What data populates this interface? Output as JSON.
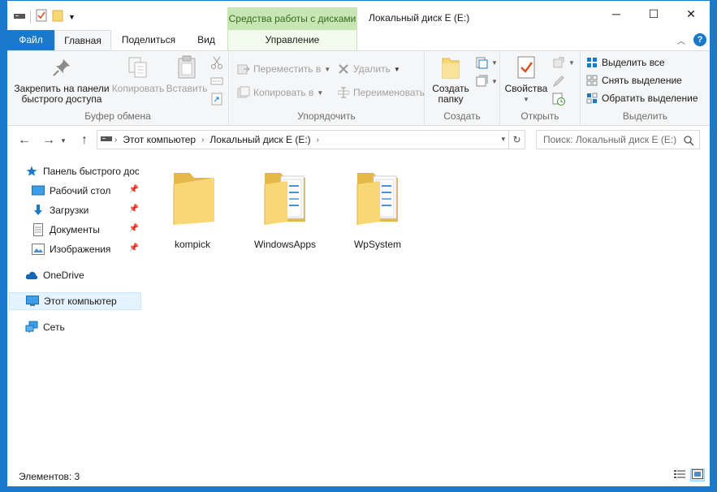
{
  "window": {
    "title": "Локальный диск E (E:)",
    "context_tools_label": "Средства работы с дисками",
    "minimize_glyph": "─",
    "maximize_glyph": "☐",
    "close_glyph": "✕"
  },
  "tabs": {
    "file": "Файл",
    "home": "Главная",
    "share": "Поделиться",
    "view": "Вид",
    "manage": "Управление"
  },
  "ribbon": {
    "clipboard": {
      "label": "Буфер обмена",
      "pin_line1": "Закрепить на панели",
      "pin_line2": "быстрого доступа",
      "copy": "Копировать",
      "paste": "Вставить"
    },
    "organize": {
      "label": "Упорядочить",
      "move_to": "Переместить в",
      "copy_to": "Копировать в",
      "delete": "Удалить",
      "rename": "Переименовать"
    },
    "new": {
      "label": "Создать",
      "new_folder_line1": "Создать",
      "new_folder_line2": "папку"
    },
    "open": {
      "label": "Открыть",
      "properties": "Свойства"
    },
    "select": {
      "label": "Выделить",
      "select_all": "Выделить все",
      "select_none": "Снять выделение",
      "invert": "Обратить выделение"
    }
  },
  "address": {
    "crumbs": [
      "Этот компьютер",
      "Локальный диск E (E:)"
    ],
    "search_placeholder": "Поиск: Локальный диск E (E:)"
  },
  "nav": {
    "quick_access": "Панель быстрого доступа",
    "desktop": "Рабочий стол",
    "downloads": "Загрузки",
    "documents": "Документы",
    "pictures": "Изображения",
    "onedrive": "OneDrive",
    "this_pc": "Этот компьютер",
    "network": "Сеть"
  },
  "files": [
    {
      "name": "kompick",
      "type": "empty-folder"
    },
    {
      "name": "WindowsApps",
      "type": "folder-with-files"
    },
    {
      "name": "WpSystem",
      "type": "folder-with-files"
    }
  ],
  "status": {
    "items_count": "Элементов: 3"
  },
  "colors": {
    "accent": "#1979ca",
    "context_green": "#c8e6b4",
    "folder_yellow": "#f8d775"
  }
}
